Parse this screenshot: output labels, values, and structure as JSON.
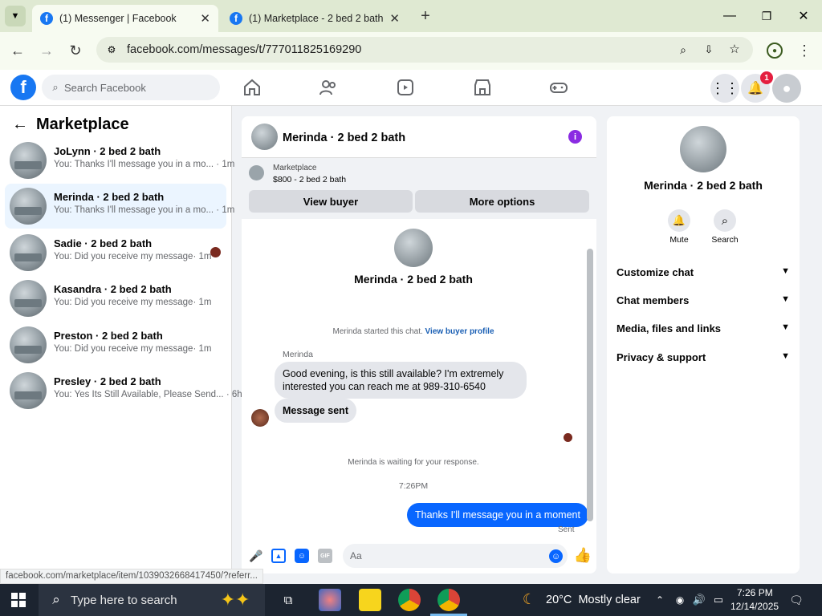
{
  "browser": {
    "tabs": [
      {
        "title": "(1) Messenger | Facebook"
      },
      {
        "title": "(1) Marketplace - 2 bed 2 bath"
      }
    ],
    "url": "facebook.com/messages/t/777011825169290"
  },
  "fb": {
    "search_placeholder": "Search Facebook",
    "notification_count": "1"
  },
  "left": {
    "title": "Marketplace",
    "conversations": [
      {
        "name": "JoLynn · 2 bed 2 bath",
        "preview": "You: Thanks I'll message you in a mo...",
        "time": "· 1m"
      },
      {
        "name": "Merinda · 2 bed 2 bath",
        "preview": "You: Thanks I'll message you in a mo...",
        "time": "· 1m"
      },
      {
        "name": "Sadie · 2 bed 2 bath",
        "preview": "You: Did you receive my message",
        "time": "· 1m"
      },
      {
        "name": "Kasandra · 2 bed 2 bath",
        "preview": "You: Did you receive my message",
        "time": "· 1m"
      },
      {
        "name": "Preston · 2 bed 2 bath",
        "preview": "You: Did you receive my message",
        "time": "· 1m"
      },
      {
        "name": "Presley · 2 bed 2 bath",
        "preview": "You: Yes Its Still Available, Please Send...",
        "time": "· 6h"
      }
    ]
  },
  "chat": {
    "header_name": "Merinda · 2 bed 2 bath",
    "marketplace_label": "Marketplace",
    "listing": "$800 - 2 bed 2 bath",
    "view_buyer": "View buyer",
    "more_options": "More options",
    "profile_name": "Merinda · 2 bed 2 bath",
    "started_text": "Merinda started this chat.",
    "view_buyer_profile": "View buyer profile",
    "sender_name": "Merinda",
    "msg1": "Good evening, is this still available? I'm extremely interested you can reach me at 989-310-6540",
    "msg2": "Message sent",
    "waiting": "Merinda is waiting for your response.",
    "time": "7:26PM",
    "my_msg": "Thanks I'll message you in a moment",
    "sent": "Sent",
    "composer_placeholder": "Aa"
  },
  "right": {
    "name": "Merinda · 2 bed 2 bath",
    "mute": "Mute",
    "search": "Search",
    "sections": [
      "Customize chat",
      "Chat members",
      "Media, files and links",
      "Privacy & support"
    ]
  },
  "status_url": "facebook.com/marketplace/item/1039032668417450/?referr...",
  "taskbar": {
    "search_placeholder": "Type here to search",
    "weather": "20°C  Mostly clear",
    "time": "7:26 PM",
    "date": "12/14/2025"
  }
}
